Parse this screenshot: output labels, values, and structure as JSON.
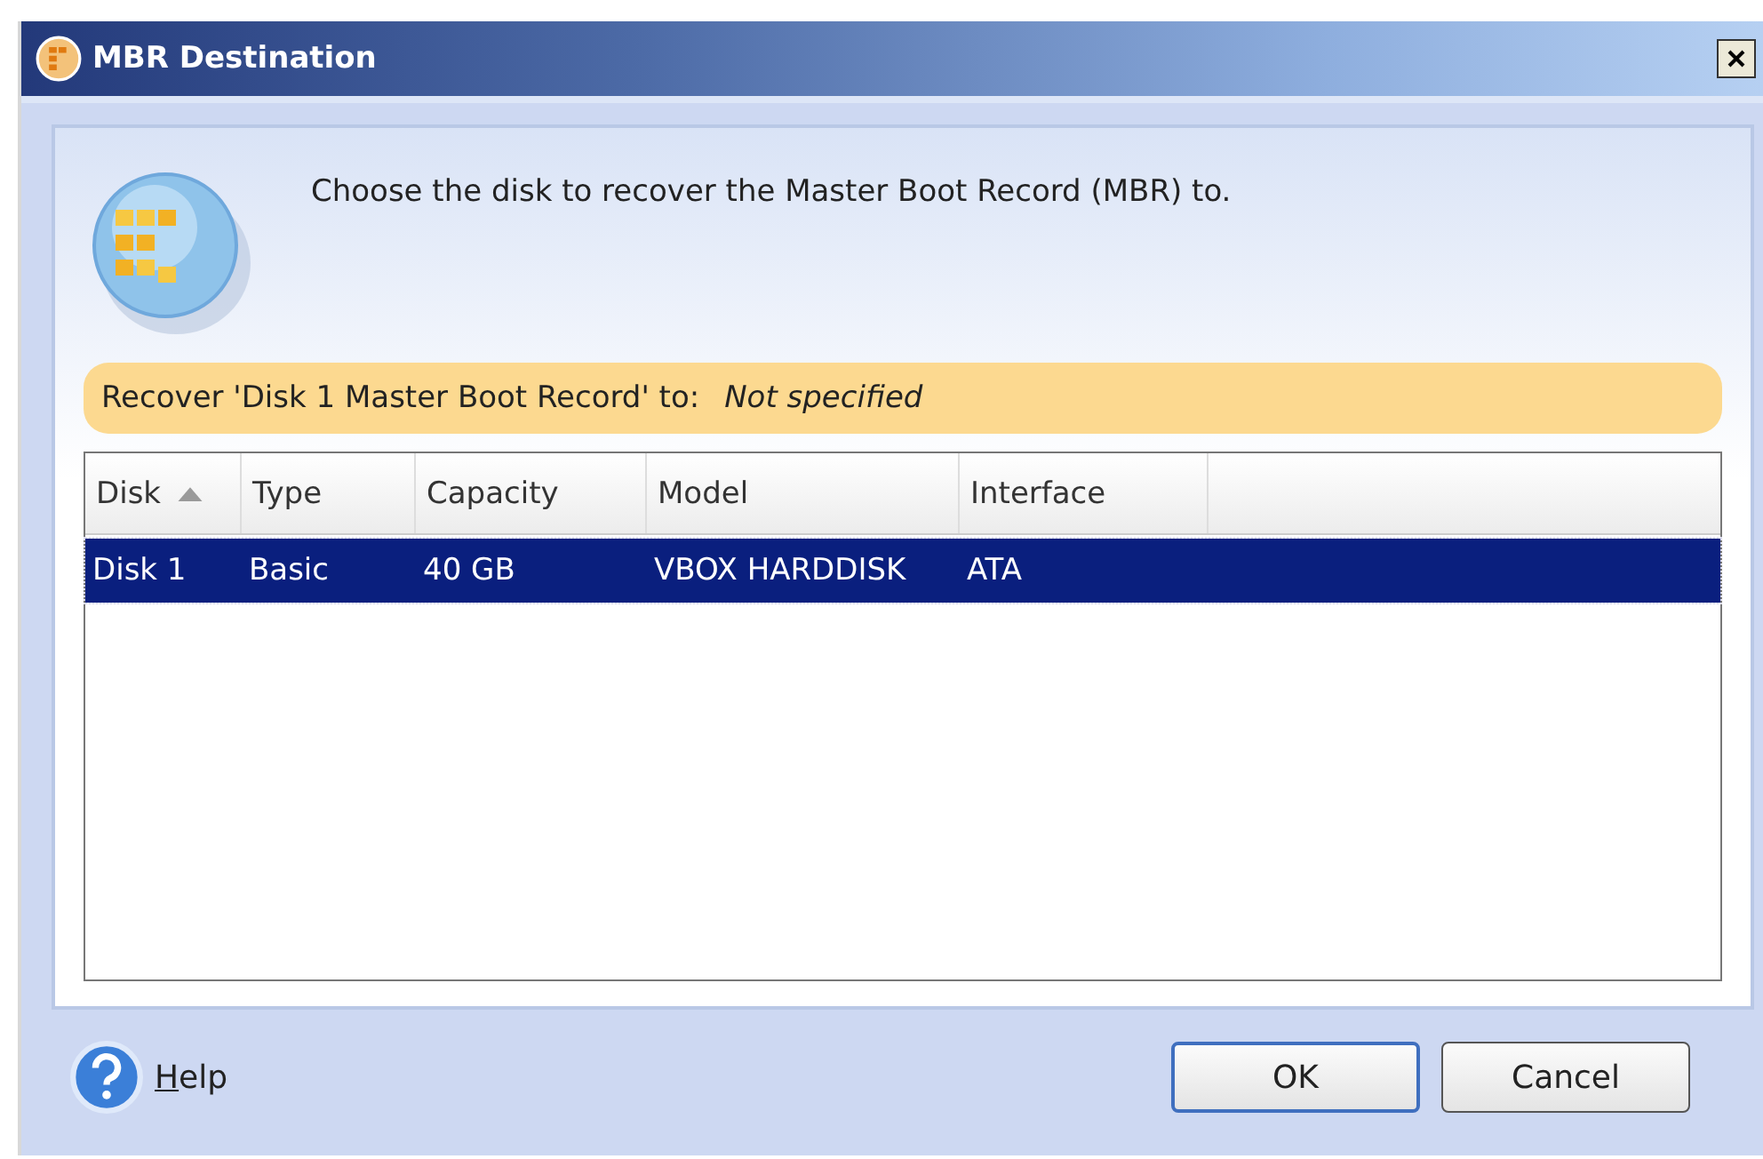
{
  "window": {
    "title": "MBR Destination"
  },
  "instruction": "Choose the disk to recover the Master Boot Record (MBR) to.",
  "destination": {
    "label": "Recover 'Disk 1 Master Boot Record' to:",
    "value": "Not specified"
  },
  "table": {
    "columns": [
      {
        "label": "Disk",
        "sorted": true
      },
      {
        "label": "Type",
        "sorted": false
      },
      {
        "label": "Capacity",
        "sorted": false
      },
      {
        "label": "Model",
        "sorted": false
      },
      {
        "label": "Interface",
        "sorted": false
      }
    ],
    "rows": [
      {
        "cells": [
          "Disk 1",
          "Basic",
          "40 GB",
          "VBOX HARDDISK",
          "ATA"
        ],
        "selected": true
      }
    ]
  },
  "help": "Help",
  "buttons": [
    {
      "label": "OK",
      "default": true
    },
    {
      "label": "Cancel",
      "default": false
    }
  ]
}
